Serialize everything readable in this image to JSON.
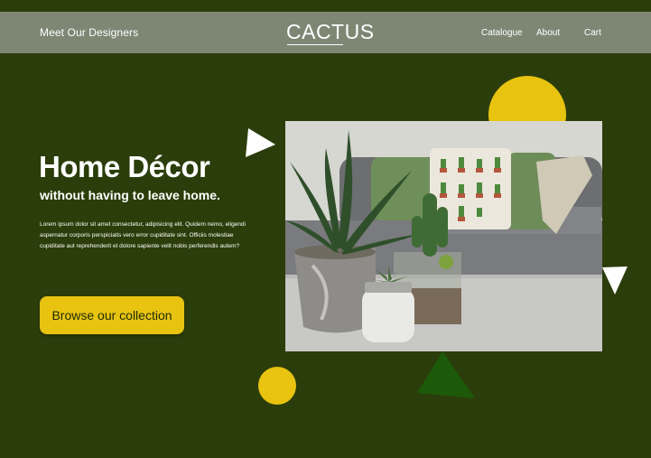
{
  "nav": {
    "left_link": "Meet Our Designers",
    "brand": "CACTUS",
    "links": [
      "Catalogue",
      "About",
      "Cart"
    ]
  },
  "hero": {
    "title": "Home Décor",
    "subtitle": "without having to leave home.",
    "body": "Lorem ipsum dolor sit amet consectetur, adipisicing elit. Quidem nemo, eligendi aspernatur corporis perspiciatis vero error cupiditate sint. Officiis molestiae cupiditate aut reprehenderit et dolore sapiente velit nobis perferendis autem?",
    "cta_label": "Browse our collection"
  },
  "colors": {
    "background": "#2b3d0a",
    "navbar": "#7e8774",
    "accent_yellow": "#e8c411",
    "accent_green": "#1c5a0a",
    "white": "#ffffff"
  },
  "image": {
    "subject": "living-room-plants-photo"
  }
}
